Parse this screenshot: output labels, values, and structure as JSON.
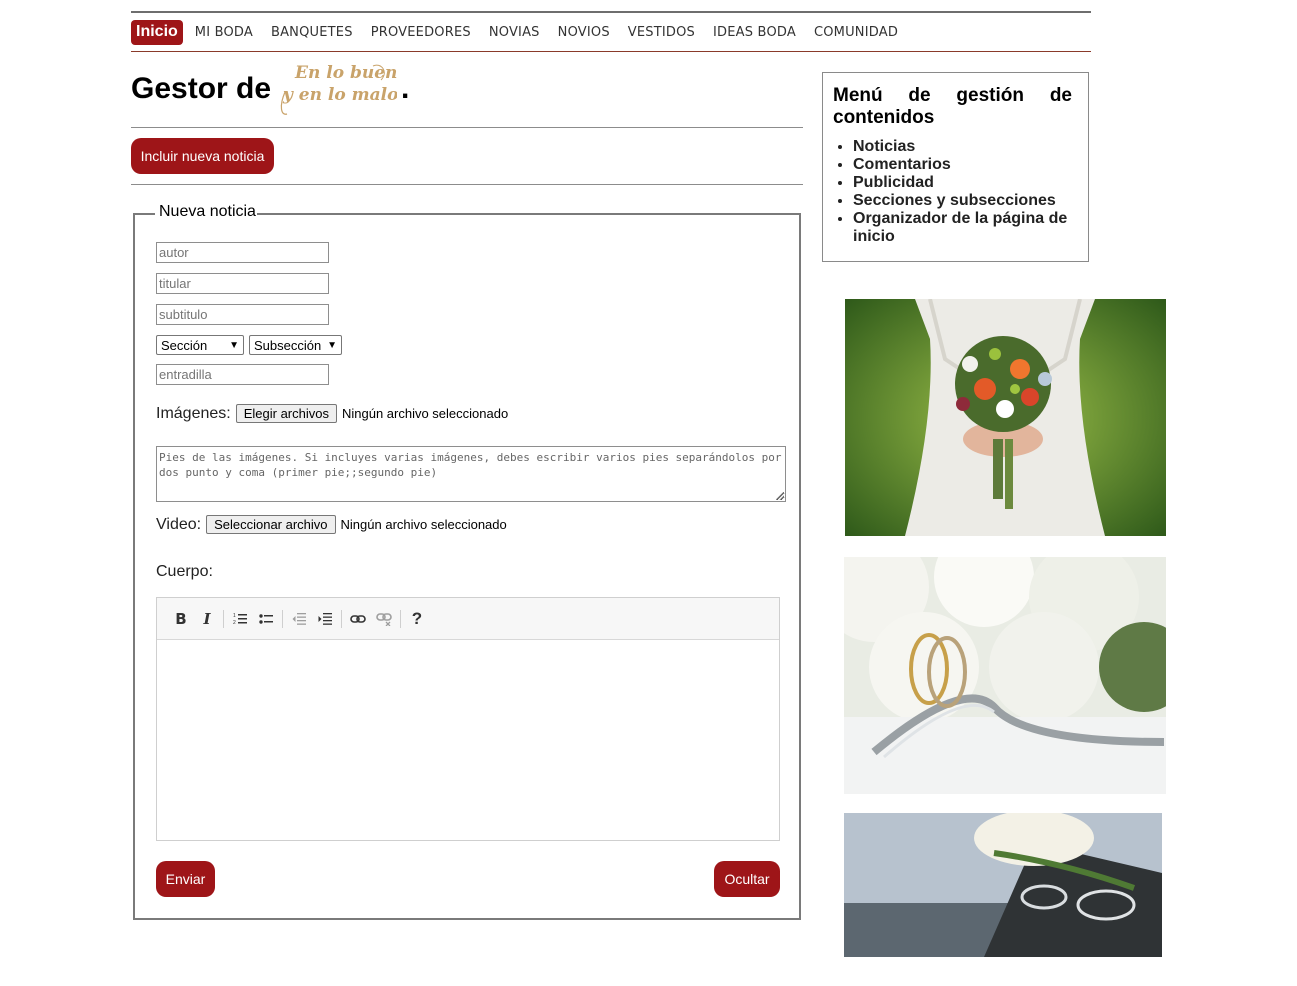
{
  "nav": {
    "items": [
      "Inicio",
      "MI BODA",
      "BANQUETES",
      "PROVEEDORES",
      "NOVIAS",
      "NOVIOS",
      "VESTIDOS",
      "IDEAS BODA",
      "COMUNIDAD"
    ],
    "active_color": "#9e1518"
  },
  "header": {
    "title_prefix": "Gestor de",
    "title_suffix": ".",
    "logo_text_line1": "En lo bueno",
    "logo_text_line2": "y en lo malo"
  },
  "actions": {
    "add_news_label": "Incluir nueva noticia"
  },
  "form": {
    "legend": "Nueva noticia",
    "author_placeholder": "autor",
    "headline_placeholder": "titular",
    "subtitle_placeholder": "subtitulo",
    "section_select": "Sección",
    "subsection_select": "Subsección",
    "lead_placeholder": "entradilla",
    "images_label": "Imágenes:",
    "images_button": "Elegir archivos",
    "images_status": "Ningún archivo seleccionado",
    "captions_placeholder": "Pies de las imágenes. Si incluyes varias imágenes, debes escribir varios pies separándolos por dos punto y coma (primer pie;;segundo pie)",
    "video_label": "Video:",
    "video_button": "Seleccionar archivo",
    "video_status": "Ningún archivo seleccionado",
    "body_label": "Cuerpo:",
    "toolbar": {
      "bold": "B",
      "italic": "I",
      "ordered_list": "ordered-list-icon",
      "bullet_list": "bullet-list-icon",
      "outdent": "outdent-icon",
      "indent": "indent-icon",
      "link": "link-icon",
      "unlink": "unlink-icon",
      "help": "?"
    },
    "send_label": "Enviar",
    "hide_label": "Ocultar"
  },
  "sidebar": {
    "title": "Menú de gestión de contenidos",
    "items": [
      "Noticias",
      "Comentarios",
      "Publicidad",
      "Secciones y subsecciones",
      "Organizador de la página de inicio"
    ]
  },
  "images": [
    "bride-bouquet-photo",
    "wedding-rings-roses-photo",
    "rings-white-rose-photo"
  ],
  "colors": {
    "brand": "#9e1518",
    "logo_gold": "#c9a36a"
  }
}
